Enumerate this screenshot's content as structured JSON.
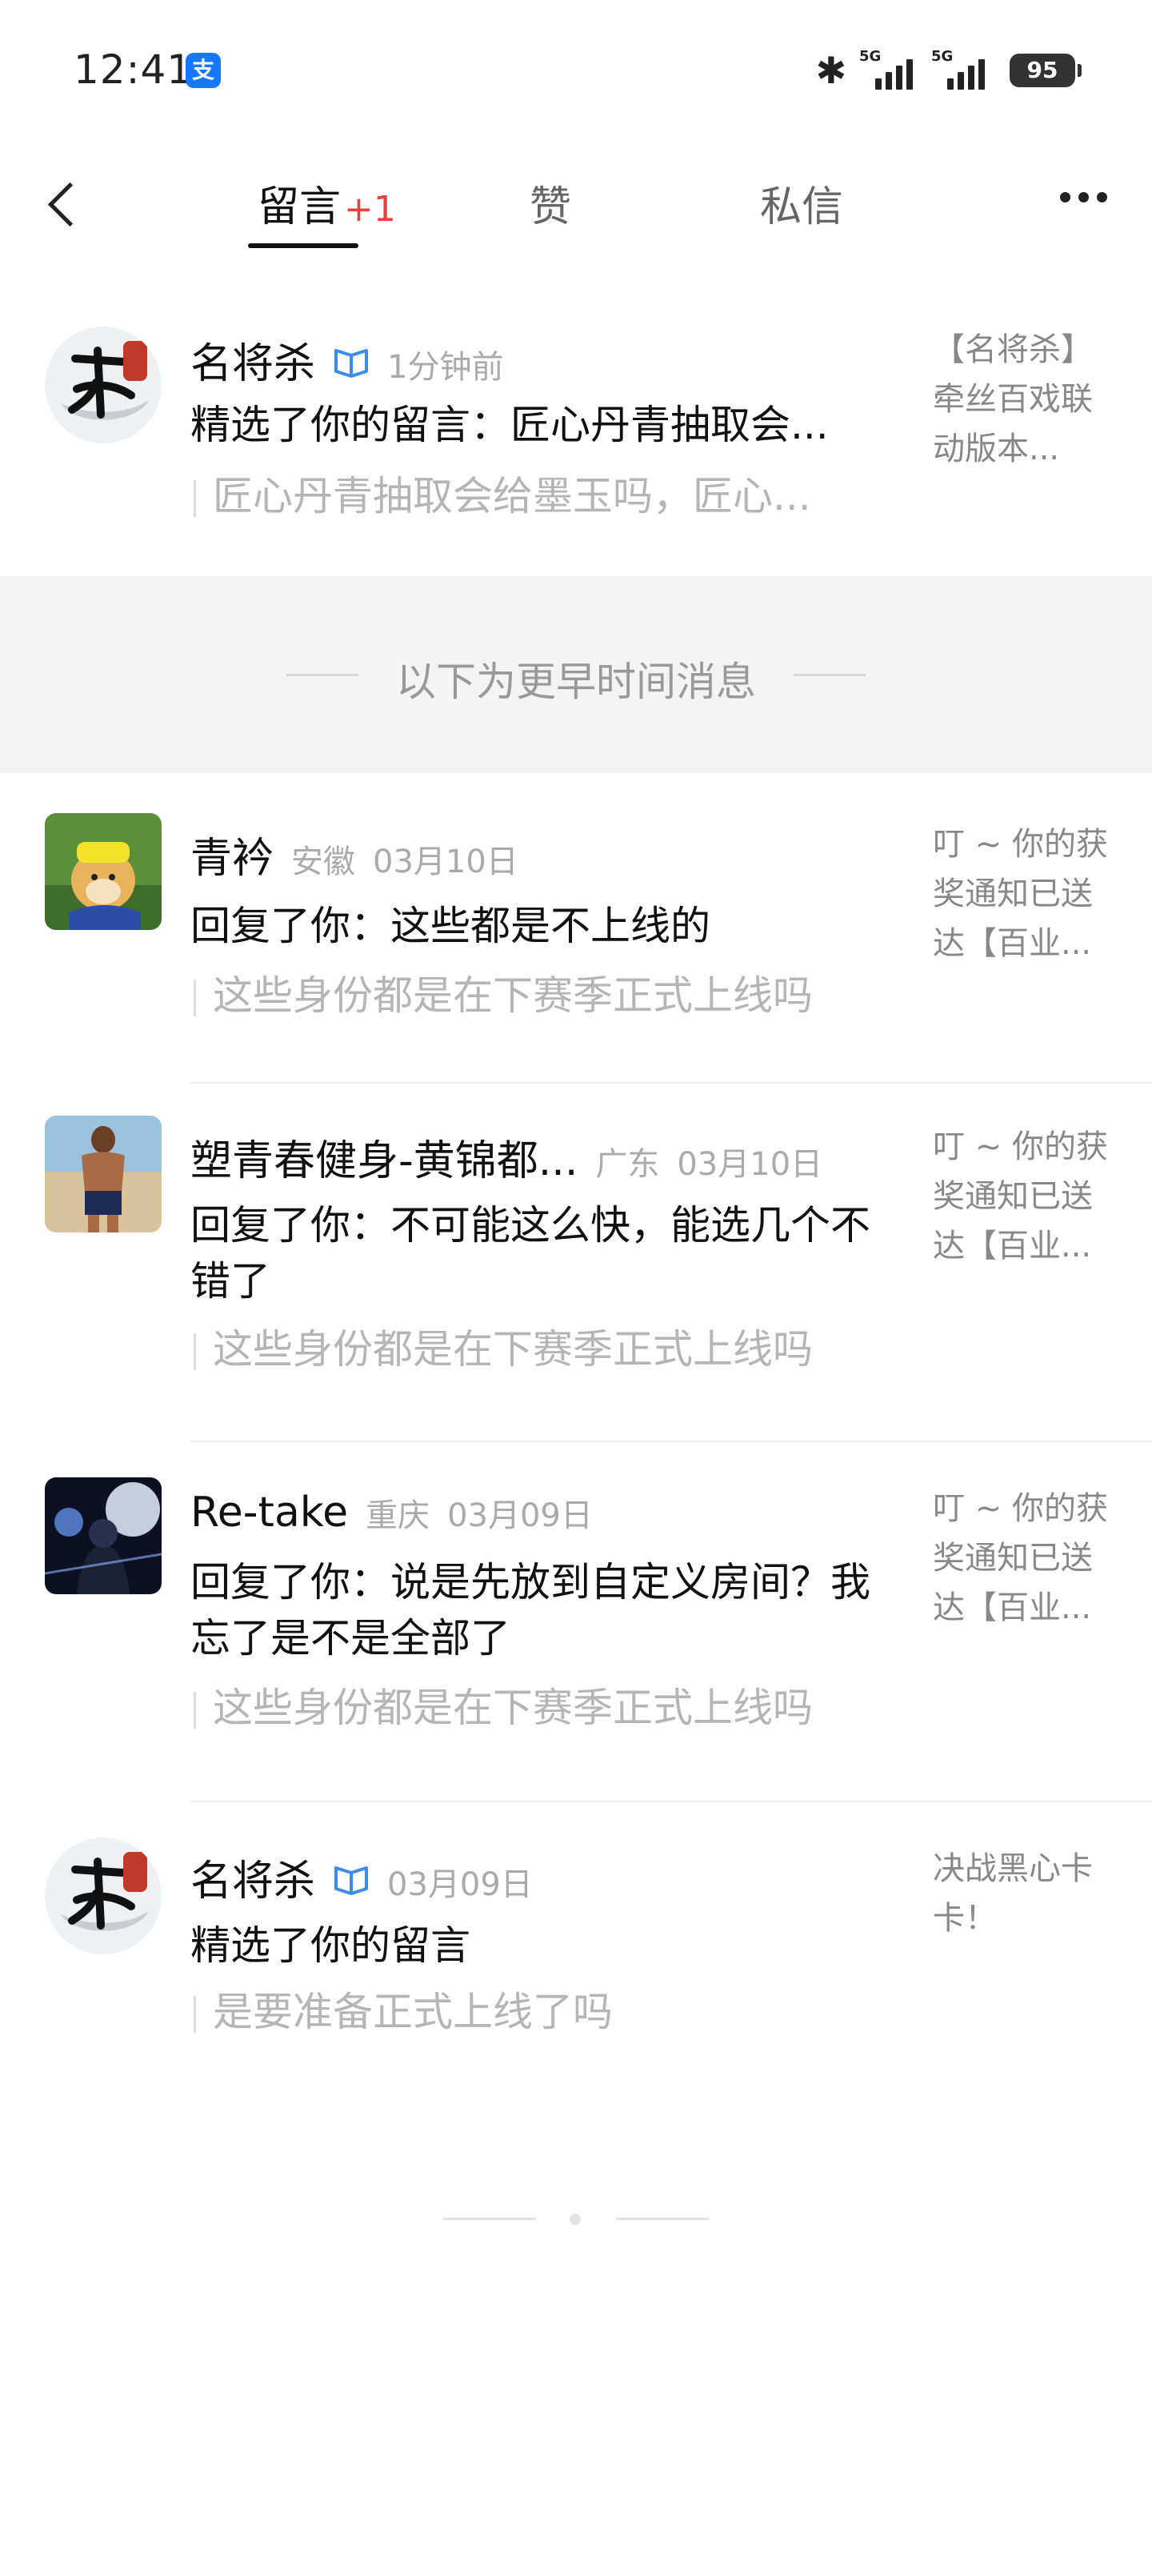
{
  "status_bar": {
    "time": "12:41",
    "pay_icon_label": "支",
    "signal_1_label": "5G",
    "signal_2_label": "5G",
    "battery": "95"
  },
  "header": {
    "tabs": [
      {
        "label": "留言",
        "badge": "+1",
        "active": true
      },
      {
        "label": "赞",
        "active": false
      },
      {
        "label": "私信",
        "active": false
      }
    ]
  },
  "divider_text": "以下为更早时间消息",
  "messages": [
    {
      "name": "名将杀",
      "verified": true,
      "location": "",
      "time": "1分钟前",
      "action": "精选了你的留言：匠心丹青抽取会...",
      "quote": "匠心丹青抽取会给墨玉吗，匠心...",
      "side": "【名将杀】牵丝百戏联动版本..."
    },
    {
      "name": "青衿",
      "verified": false,
      "location": "安徽",
      "time": "03月10日",
      "action": "回复了你：这些都是不上线的",
      "quote": "这些身份都是在下赛季正式上线吗",
      "side": "叮 ~ 你的获奖通知已送达【百业..."
    },
    {
      "name": "塑青春健身-黄锦都...",
      "verified": false,
      "location": "广东",
      "time": "03月10日",
      "action": "回复了你：不可能这么快，能选几个不错了",
      "quote": "这些身份都是在下赛季正式上线吗",
      "side": "叮 ~ 你的获奖通知已送达【百业..."
    },
    {
      "name": "Re-take",
      "verified": false,
      "location": "重庆",
      "time": "03月09日",
      "action": "回复了你：说是先放到自定义房间？我忘了是不是全部了",
      "quote": "这些身份都是在下赛季正式上线吗",
      "side": "叮 ~ 你的获奖通知已送达【百业..."
    },
    {
      "name": "名将杀",
      "verified": true,
      "location": "",
      "time": "03月09日",
      "action": "精选了你的留言",
      "quote": "是要准备正式上线了吗",
      "side": "决战黑心卡卡！"
    }
  ]
}
